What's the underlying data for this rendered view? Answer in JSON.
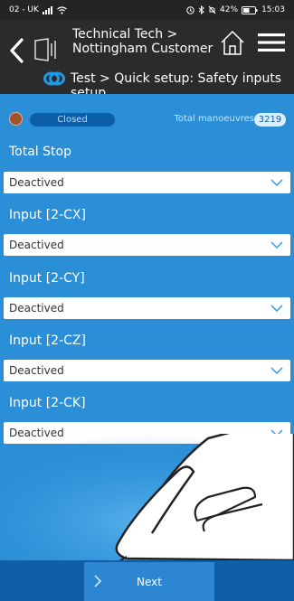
{
  "statusbar": {
    "carrier": "02 - UK",
    "signal_icon": "signal-icon",
    "wifi_icon": "wifi-icon",
    "battery_percent": "42%",
    "time": "15:03"
  },
  "header": {
    "title_line1": "Technical Tech >",
    "title_line2": "Nottingham Customer",
    "breadcrumb": "Test > Quick setup: Safety inputs setup"
  },
  "status": {
    "state_label": "Closed",
    "manoeuvres_label": "Total manoeuvres",
    "manoeuvres_count": "3219",
    "dot_color": "#a0522d"
  },
  "fields": [
    {
      "label": "Total Stop",
      "value": "Deactived"
    },
    {
      "label": "Input [2-CX]",
      "value": "Deactived"
    },
    {
      "label": "Input [2-CY]",
      "value": "Deactived"
    },
    {
      "label": "Input [2-CZ]",
      "value": "Deactived"
    },
    {
      "label": "Input [2-CK]",
      "value": "Deactived"
    }
  ],
  "footer": {
    "next_label": "Next"
  },
  "colors": {
    "accent": "#2a8fd6",
    "header_bg": "#2b2b2b",
    "footer_bg": "#0f5ea8"
  }
}
